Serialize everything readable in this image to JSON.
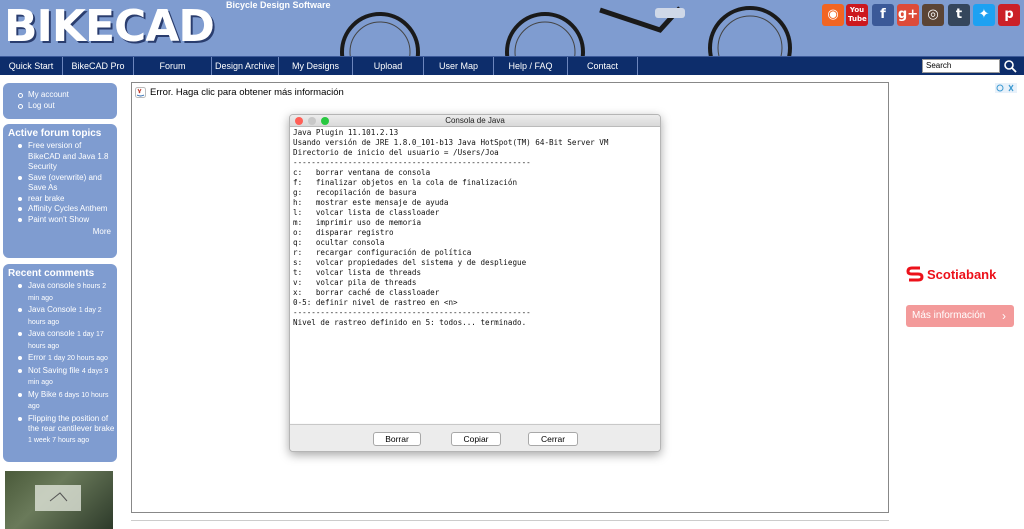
{
  "header": {
    "logo": "BIKECAD",
    "tagline": "Bicycle Design Software",
    "social": [
      {
        "icon": "rss-icon",
        "glyph": "◉",
        "color": "#f26522"
      },
      {
        "icon": "youtube-icon",
        "glyph": "You Tube",
        "color": "#cc181e"
      },
      {
        "icon": "facebook-icon",
        "glyph": "f",
        "color": "#3b5998"
      },
      {
        "icon": "google-plus-icon",
        "glyph": "g+",
        "color": "#dd4b39"
      },
      {
        "icon": "instagram-icon",
        "glyph": "◎",
        "color": "#5b4435"
      },
      {
        "icon": "tumblr-icon",
        "glyph": "t",
        "color": "#35465c"
      },
      {
        "icon": "twitter-icon",
        "glyph": "✦",
        "color": "#1da1f2"
      },
      {
        "icon": "pinterest-icon",
        "glyph": "p",
        "color": "#cb2027"
      }
    ]
  },
  "nav": {
    "items": [
      "Quick Start",
      "BikeCAD Pro",
      "Forum",
      "Design Archive",
      "My Designs",
      "Upload",
      "User Map",
      "Help / FAQ",
      "Contact"
    ],
    "search_value": "Search"
  },
  "sidebar": {
    "account_links": [
      "My account",
      "Log out"
    ],
    "forum": {
      "title": "Active forum topics",
      "items": [
        "Free version of BikeCAD and Java 1.8 Security",
        "Save (overwrite) and Save As",
        "rear brake",
        "Affinity Cycles Anthem",
        "Paint won't Show"
      ],
      "more": "More"
    },
    "comments": {
      "title": "Recent comments",
      "items": [
        {
          "title": "Java console",
          "meta": "9 hours 2 min ago"
        },
        {
          "title": "Java Console",
          "meta": "1 day 2 hours ago"
        },
        {
          "title": "Java console",
          "meta": "1 day 17 hours ago"
        },
        {
          "title": "Error",
          "meta": "1 day 20 hours ago"
        },
        {
          "title": "Not Saving file",
          "meta": "4 days 9 min ago"
        },
        {
          "title": "My Bike",
          "meta": "6 days 10 hours ago"
        },
        {
          "title": "Flipping the position of the rear cantilever brake",
          "meta": "1 week 7 hours ago"
        }
      ]
    }
  },
  "main": {
    "error_message": "Error. Haga clic para obtener más información"
  },
  "console": {
    "title": "Consola de Java",
    "lines": [
      "Java Plugin 11.101.2.13",
      "Usando versión de JRE 1.8.0_101-b13 Java HotSpot(TM) 64-Bit Server VM",
      "Directorio de inicio del usuario = /Users/Joa",
      "----------------------------------------------------",
      "c:   borrar ventana de consola",
      "f:   finalizar objetos en la cola de finalización",
      "g:   recopilación de basura",
      "h:   mostrar este mensaje de ayuda",
      "l:   volcar lista de classloader",
      "m:   imprimir uso de memoria",
      "o:   disparar registro",
      "q:   ocultar consola",
      "r:   recargar configuración de política",
      "s:   volcar propiedades del sistema y de despliegue",
      "t:   volcar lista de threads",
      "v:   volcar pila de threads",
      "x:   borrar caché de classloader",
      "0-5: definir nivel de rastreo en <n>",
      "----------------------------------------------------",
      "Nivel de rastreo definido en 5: todos... terminado."
    ],
    "buttons": [
      "Borrar",
      "Copiar",
      "Cerrar"
    ]
  },
  "ad": {
    "brand": "Scotiabank",
    "cta": "Más información",
    "brand_color": "#ec111a"
  },
  "colors": {
    "header_bg": "#7f9cd0",
    "nav_bg": "#0d2d6b",
    "sidebar_bg": "#7f9cd0"
  }
}
